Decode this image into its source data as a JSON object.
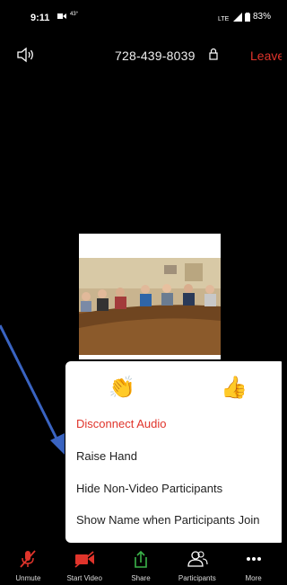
{
  "status_bar": {
    "time": "9:11",
    "temperature": "43°",
    "battery": "83%"
  },
  "meeting": {
    "id": "728-439-8039",
    "leave_label": "Leave"
  },
  "colors": {
    "danger": "#e0342b",
    "share_green": "#3bb34a",
    "background": "#000000",
    "popup_bg": "#ffffff"
  },
  "reactions_menu": {
    "reactions": [
      "👏",
      "👍"
    ],
    "items": [
      "Disconnect Audio",
      "Raise Hand",
      "Hide Non-Video Participants",
      "Show Name when Participants Join"
    ]
  },
  "toolbar": {
    "items": [
      {
        "label": "Unmute",
        "icon": "muted-mic-icon"
      },
      {
        "label": "Start Video",
        "icon": "video-off-icon"
      },
      {
        "label": "Share",
        "icon": "share-icon"
      },
      {
        "label": "Participants",
        "icon": "participants-icon"
      },
      {
        "label": "More",
        "icon": "more-icon"
      }
    ]
  }
}
